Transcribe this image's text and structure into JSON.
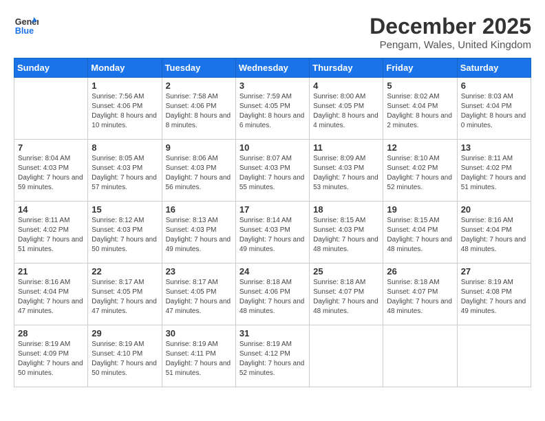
{
  "logo": {
    "text_general": "General",
    "text_blue": "Blue"
  },
  "title": {
    "month_year": "December 2025",
    "location": "Pengam, Wales, United Kingdom"
  },
  "days_of_week": [
    "Sunday",
    "Monday",
    "Tuesday",
    "Wednesday",
    "Thursday",
    "Friday",
    "Saturday"
  ],
  "weeks": [
    [
      {
        "day": "",
        "sunrise": "",
        "sunset": "",
        "daylight": ""
      },
      {
        "day": "1",
        "sunrise": "Sunrise: 7:56 AM",
        "sunset": "Sunset: 4:06 PM",
        "daylight": "Daylight: 8 hours and 10 minutes."
      },
      {
        "day": "2",
        "sunrise": "Sunrise: 7:58 AM",
        "sunset": "Sunset: 4:06 PM",
        "daylight": "Daylight: 8 hours and 8 minutes."
      },
      {
        "day": "3",
        "sunrise": "Sunrise: 7:59 AM",
        "sunset": "Sunset: 4:05 PM",
        "daylight": "Daylight: 8 hours and 6 minutes."
      },
      {
        "day": "4",
        "sunrise": "Sunrise: 8:00 AM",
        "sunset": "Sunset: 4:05 PM",
        "daylight": "Daylight: 8 hours and 4 minutes."
      },
      {
        "day": "5",
        "sunrise": "Sunrise: 8:02 AM",
        "sunset": "Sunset: 4:04 PM",
        "daylight": "Daylight: 8 hours and 2 minutes."
      },
      {
        "day": "6",
        "sunrise": "Sunrise: 8:03 AM",
        "sunset": "Sunset: 4:04 PM",
        "daylight": "Daylight: 8 hours and 0 minutes."
      }
    ],
    [
      {
        "day": "7",
        "sunrise": "Sunrise: 8:04 AM",
        "sunset": "Sunset: 4:03 PM",
        "daylight": "Daylight: 7 hours and 59 minutes."
      },
      {
        "day": "8",
        "sunrise": "Sunrise: 8:05 AM",
        "sunset": "Sunset: 4:03 PM",
        "daylight": "Daylight: 7 hours and 57 minutes."
      },
      {
        "day": "9",
        "sunrise": "Sunrise: 8:06 AM",
        "sunset": "Sunset: 4:03 PM",
        "daylight": "Daylight: 7 hours and 56 minutes."
      },
      {
        "day": "10",
        "sunrise": "Sunrise: 8:07 AM",
        "sunset": "Sunset: 4:03 PM",
        "daylight": "Daylight: 7 hours and 55 minutes."
      },
      {
        "day": "11",
        "sunrise": "Sunrise: 8:09 AM",
        "sunset": "Sunset: 4:03 PM",
        "daylight": "Daylight: 7 hours and 53 minutes."
      },
      {
        "day": "12",
        "sunrise": "Sunrise: 8:10 AM",
        "sunset": "Sunset: 4:02 PM",
        "daylight": "Daylight: 7 hours and 52 minutes."
      },
      {
        "day": "13",
        "sunrise": "Sunrise: 8:11 AM",
        "sunset": "Sunset: 4:02 PM",
        "daylight": "Daylight: 7 hours and 51 minutes."
      }
    ],
    [
      {
        "day": "14",
        "sunrise": "Sunrise: 8:11 AM",
        "sunset": "Sunset: 4:02 PM",
        "daylight": "Daylight: 7 hours and 51 minutes."
      },
      {
        "day": "15",
        "sunrise": "Sunrise: 8:12 AM",
        "sunset": "Sunset: 4:03 PM",
        "daylight": "Daylight: 7 hours and 50 minutes."
      },
      {
        "day": "16",
        "sunrise": "Sunrise: 8:13 AM",
        "sunset": "Sunset: 4:03 PM",
        "daylight": "Daylight: 7 hours and 49 minutes."
      },
      {
        "day": "17",
        "sunrise": "Sunrise: 8:14 AM",
        "sunset": "Sunset: 4:03 PM",
        "daylight": "Daylight: 7 hours and 49 minutes."
      },
      {
        "day": "18",
        "sunrise": "Sunrise: 8:15 AM",
        "sunset": "Sunset: 4:03 PM",
        "daylight": "Daylight: 7 hours and 48 minutes."
      },
      {
        "day": "19",
        "sunrise": "Sunrise: 8:15 AM",
        "sunset": "Sunset: 4:04 PM",
        "daylight": "Daylight: 7 hours and 48 minutes."
      },
      {
        "day": "20",
        "sunrise": "Sunrise: 8:16 AM",
        "sunset": "Sunset: 4:04 PM",
        "daylight": "Daylight: 7 hours and 48 minutes."
      }
    ],
    [
      {
        "day": "21",
        "sunrise": "Sunrise: 8:16 AM",
        "sunset": "Sunset: 4:04 PM",
        "daylight": "Daylight: 7 hours and 47 minutes."
      },
      {
        "day": "22",
        "sunrise": "Sunrise: 8:17 AM",
        "sunset": "Sunset: 4:05 PM",
        "daylight": "Daylight: 7 hours and 47 minutes."
      },
      {
        "day": "23",
        "sunrise": "Sunrise: 8:17 AM",
        "sunset": "Sunset: 4:05 PM",
        "daylight": "Daylight: 7 hours and 47 minutes."
      },
      {
        "day": "24",
        "sunrise": "Sunrise: 8:18 AM",
        "sunset": "Sunset: 4:06 PM",
        "daylight": "Daylight: 7 hours and 48 minutes."
      },
      {
        "day": "25",
        "sunrise": "Sunrise: 8:18 AM",
        "sunset": "Sunset: 4:07 PM",
        "daylight": "Daylight: 7 hours and 48 minutes."
      },
      {
        "day": "26",
        "sunrise": "Sunrise: 8:18 AM",
        "sunset": "Sunset: 4:07 PM",
        "daylight": "Daylight: 7 hours and 48 minutes."
      },
      {
        "day": "27",
        "sunrise": "Sunrise: 8:19 AM",
        "sunset": "Sunset: 4:08 PM",
        "daylight": "Daylight: 7 hours and 49 minutes."
      }
    ],
    [
      {
        "day": "28",
        "sunrise": "Sunrise: 8:19 AM",
        "sunset": "Sunset: 4:09 PM",
        "daylight": "Daylight: 7 hours and 50 minutes."
      },
      {
        "day": "29",
        "sunrise": "Sunrise: 8:19 AM",
        "sunset": "Sunset: 4:10 PM",
        "daylight": "Daylight: 7 hours and 50 minutes."
      },
      {
        "day": "30",
        "sunrise": "Sunrise: 8:19 AM",
        "sunset": "Sunset: 4:11 PM",
        "daylight": "Daylight: 7 hours and 51 minutes."
      },
      {
        "day": "31",
        "sunrise": "Sunrise: 8:19 AM",
        "sunset": "Sunset: 4:12 PM",
        "daylight": "Daylight: 7 hours and 52 minutes."
      },
      {
        "day": "",
        "sunrise": "",
        "sunset": "",
        "daylight": ""
      },
      {
        "day": "",
        "sunrise": "",
        "sunset": "",
        "daylight": ""
      },
      {
        "day": "",
        "sunrise": "",
        "sunset": "",
        "daylight": ""
      }
    ]
  ]
}
